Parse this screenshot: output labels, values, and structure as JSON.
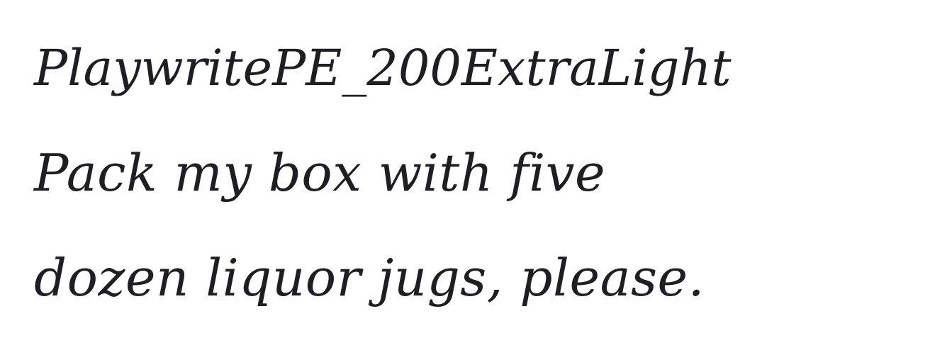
{
  "specimen": {
    "font_name": "PlaywritePE_200ExtraLight",
    "lines": [
      "Pack my box with five",
      "dozen liquor jugs, please."
    ]
  },
  "colors": {
    "text": "#1f1f23",
    "background": "#ffffff"
  }
}
